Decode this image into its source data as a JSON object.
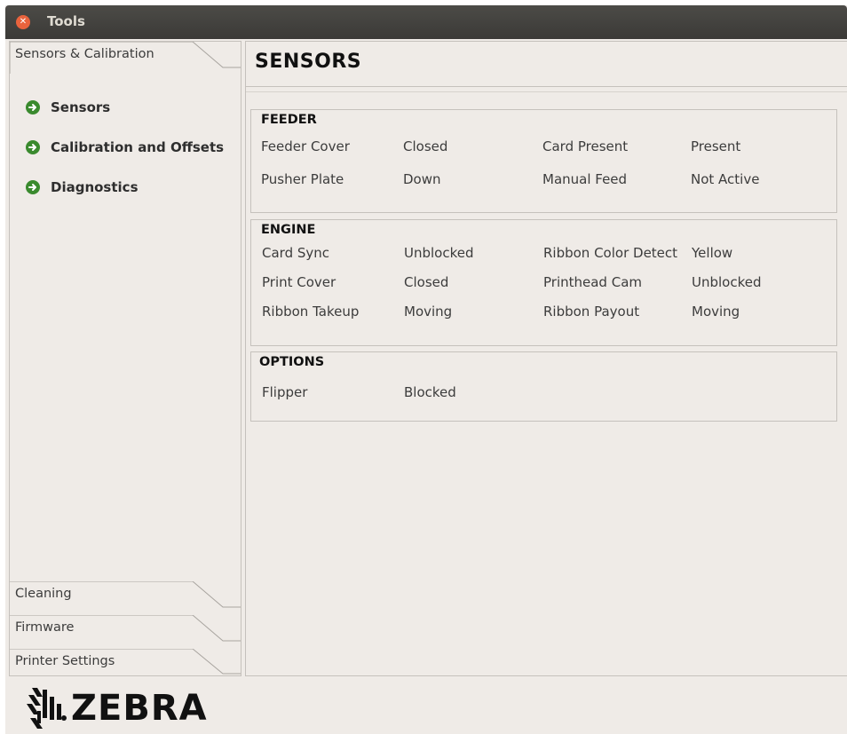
{
  "window": {
    "title": "Tools"
  },
  "sidebar": {
    "tabs": [
      {
        "label": "Sensors & Calibration"
      },
      {
        "label": "Cleaning"
      },
      {
        "label": "Firmware"
      },
      {
        "label": "Printer Settings"
      }
    ],
    "items": [
      {
        "label": "Sensors",
        "icon": "arrow-right-circle-icon"
      },
      {
        "label": "Calibration and Offsets",
        "icon": "arrow-right-circle-icon"
      },
      {
        "label": "Diagnostics",
        "icon": "arrow-right-circle-icon"
      }
    ]
  },
  "main": {
    "title": "SENSORS",
    "sections": [
      {
        "title": "FEEDER",
        "rows": [
          [
            "Feeder Cover",
            "Closed",
            "Card Present",
            "Present"
          ],
          [
            "Pusher Plate",
            "Down",
            "Manual Feed",
            "Not Active"
          ]
        ]
      },
      {
        "title": "ENGINE",
        "rows": [
          [
            "Card Sync",
            "Unblocked",
            "Ribbon Color Detect",
            "Yellow"
          ],
          [
            "Print Cover",
            "Closed",
            "Printhead Cam",
            "Unblocked"
          ],
          [
            "Ribbon Takeup",
            "Moving",
            "Ribbon Payout",
            "Moving"
          ]
        ]
      },
      {
        "title": "OPTIONS",
        "rows": [
          [
            "Flipper",
            "Blocked"
          ]
        ]
      }
    ]
  },
  "logo": {
    "text": "ZEBRA"
  },
  "colors": {
    "accent_green": "#3a8a2e",
    "titlebar": "#3e3d39",
    "close": "#e9633d"
  }
}
